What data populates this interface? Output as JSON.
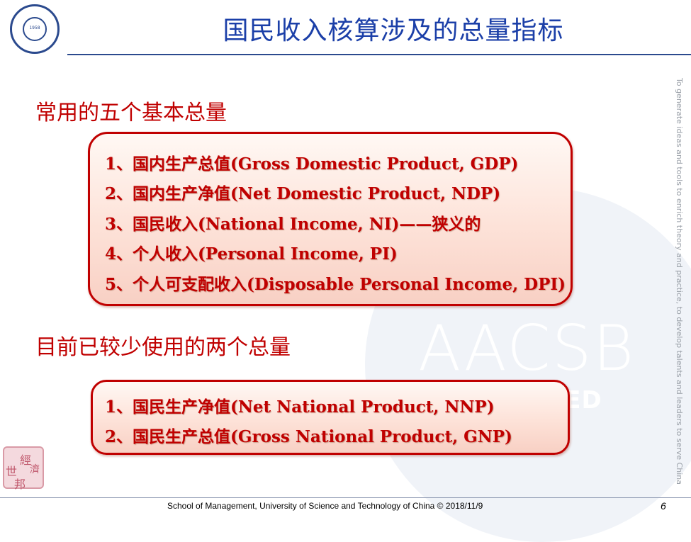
{
  "header": {
    "logo_year": "1958",
    "title": "国民收入核算涉及的总量指标"
  },
  "sections": [
    {
      "heading": "常用的五个基本总量",
      "items": [
        "1、国内生产总值(Gross Domestic Product, GDP)",
        "2、国内生产净值(Net Domestic Product, NDP)",
        "3、国民收入(National Income, NI)——狭义的",
        "4、个人收入(Personal Income, PI)",
        "5、个人可支配收入(Disposable Personal Income, DPI)"
      ]
    },
    {
      "heading": "目前已较少使用的两个总量",
      "items": [
        "1、国民生产净值(Net National Product, NNP)",
        "2、国民生产总值(Gross National Product, GNP)"
      ]
    }
  ],
  "watermark": {
    "text": "AACSB",
    "subtext": "EDITED"
  },
  "side_text": "To generate ideas and tools to enrich theory and practice, to develop talents and leaders to serve China",
  "stamp": {
    "chars": [
      "經",
      "濟",
      "世",
      "邦"
    ]
  },
  "footer": {
    "text": "School of Management, University of Science and Technology of China © 2018/11/9",
    "page_number": "6"
  },
  "colors": {
    "title": "#1b3fa8",
    "accent": "#c00000",
    "rule": "#2b4a8e"
  }
}
